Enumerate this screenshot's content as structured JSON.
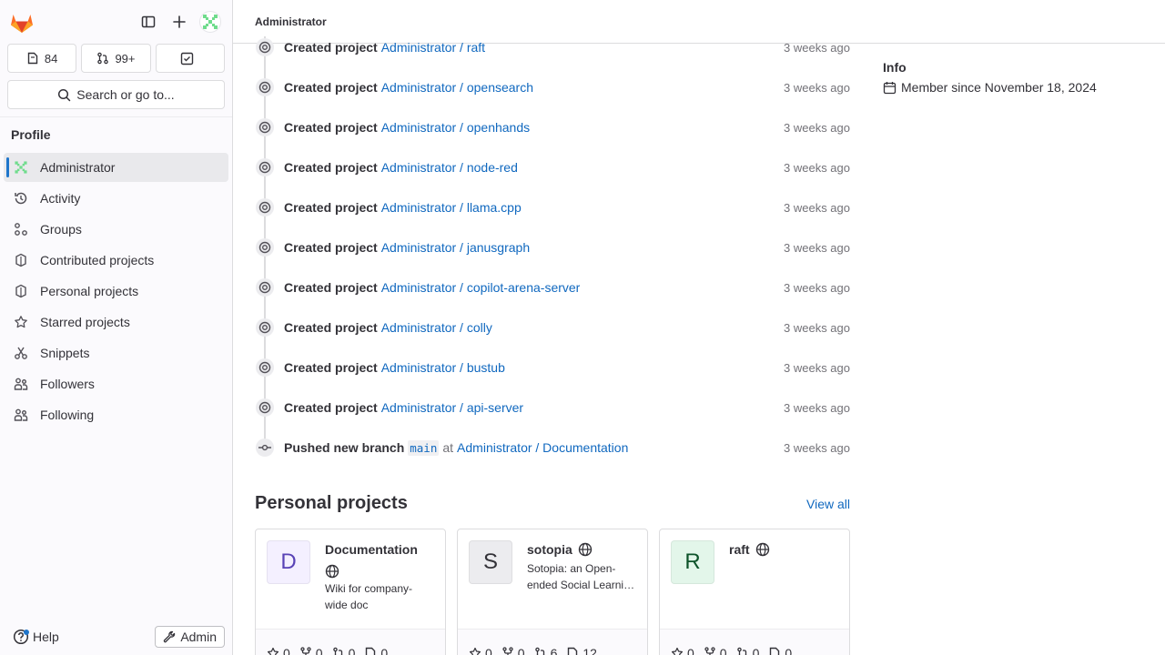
{
  "sidebar": {
    "counters": [
      {
        "label": "84",
        "icon": "issues-icon"
      },
      {
        "label": "99+",
        "icon": "merge-request-icon"
      },
      {
        "label": "",
        "icon": "todo-icon"
      }
    ],
    "search_label": "Search or go to...",
    "section_title": "Profile",
    "items": [
      {
        "label": "Administrator"
      },
      {
        "label": "Activity"
      },
      {
        "label": "Groups"
      },
      {
        "label": "Contributed projects"
      },
      {
        "label": "Personal projects"
      },
      {
        "label": "Starred projects"
      },
      {
        "label": "Snippets"
      },
      {
        "label": "Followers"
      },
      {
        "label": "Following"
      }
    ],
    "help_label": "Help",
    "admin_label": "Admin"
  },
  "header": {
    "breadcrumb": "Administrator"
  },
  "feed": {
    "events": [
      {
        "action": "Created project",
        "target": "Administrator / raft",
        "time": "3 weeks ago"
      },
      {
        "action": "Created project",
        "target": "Administrator / opensearch",
        "time": "3 weeks ago"
      },
      {
        "action": "Created project",
        "target": "Administrator / openhands",
        "time": "3 weeks ago"
      },
      {
        "action": "Created project",
        "target": "Administrator / node-red",
        "time": "3 weeks ago"
      },
      {
        "action": "Created project",
        "target": "Administrator / llama.cpp",
        "time": "3 weeks ago"
      },
      {
        "action": "Created project",
        "target": "Administrator / janusgraph",
        "time": "3 weeks ago"
      },
      {
        "action": "Created project",
        "target": "Administrator / copilot-arena-server",
        "time": "3 weeks ago"
      },
      {
        "action": "Created project",
        "target": "Administrator / colly",
        "time": "3 weeks ago"
      },
      {
        "action": "Created project",
        "target": "Administrator / bustub",
        "time": "3 weeks ago"
      },
      {
        "action": "Created project",
        "target": "Administrator / api-server",
        "time": "3 weeks ago"
      }
    ],
    "push": {
      "action": "Pushed new branch",
      "branch": "main",
      "at": "at",
      "target": "Administrator / Documentation",
      "time": "3 weeks ago"
    }
  },
  "personal_projects": {
    "title": "Personal projects",
    "view_all": "View all",
    "cards": [
      {
        "initial": "D",
        "name": "Documentation",
        "description": "Wiki for company-wide doc",
        "stars": "0",
        "forks": "0",
        "mrs": "0",
        "issues": "0",
        "avatar_bg": "#f4f0ff",
        "avatar_fg": "#5943b6"
      },
      {
        "initial": "S",
        "name": "sotopia",
        "description": "Sotopia: an Open-ended Social Learning Environment",
        "stars": "0",
        "forks": "0",
        "mrs": "6",
        "issues": "12",
        "avatar_bg": "#ececef",
        "avatar_fg": "#333238"
      },
      {
        "initial": "R",
        "name": "raft",
        "description": "",
        "stars": "0",
        "forks": "0",
        "mrs": "0",
        "issues": "0",
        "avatar_bg": "#e3f6ea",
        "avatar_fg": "#0d532a"
      }
    ]
  },
  "info": {
    "title": "Info",
    "member_since": "Member since November 18, 2024"
  },
  "colors": {
    "link": "#1068bf",
    "accent": "#1f75cb"
  }
}
